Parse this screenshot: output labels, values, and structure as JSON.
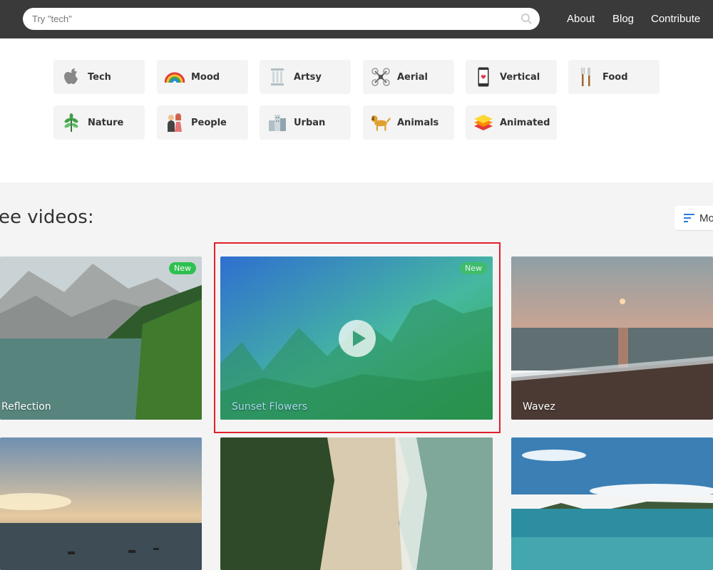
{
  "search": {
    "placeholder": "Try \"tech\""
  },
  "nav": {
    "about": "About",
    "blog": "Blog",
    "contribute": "Contribute"
  },
  "categories": [
    {
      "label": "Tech",
      "icon": "apple-icon"
    },
    {
      "label": "Mood",
      "icon": "rainbow-icon"
    },
    {
      "label": "Artsy",
      "icon": "column-icon"
    },
    {
      "label": "Aerial",
      "icon": "drone-icon"
    },
    {
      "label": "Vertical",
      "icon": "phone-icon"
    },
    {
      "label": "Food",
      "icon": "utensils-icon"
    },
    {
      "label": "Nature",
      "icon": "plant-icon"
    },
    {
      "label": "People",
      "icon": "people-icon"
    },
    {
      "label": "Urban",
      "icon": "buildings-icon"
    },
    {
      "label": "Animals",
      "icon": "dog-icon"
    },
    {
      "label": "Animated",
      "icon": "layers-icon"
    }
  ],
  "videos_section": {
    "title": "ee videos:",
    "sort_label": "Mo"
  },
  "videos": [
    {
      "title": "Reflection",
      "badge": "New"
    },
    {
      "title": "Sunset Flowers",
      "badge": "New"
    },
    {
      "title": "Wavez",
      "badge": ""
    },
    {
      "title": "",
      "badge": ""
    },
    {
      "title": "",
      "badge": ""
    },
    {
      "title": "",
      "badge": ""
    }
  ],
  "colors": {
    "header": "#3a3a3a",
    "badge": "#2ec04f",
    "highlight": "#e0202a",
    "sort_icon": "#2a7be0"
  }
}
